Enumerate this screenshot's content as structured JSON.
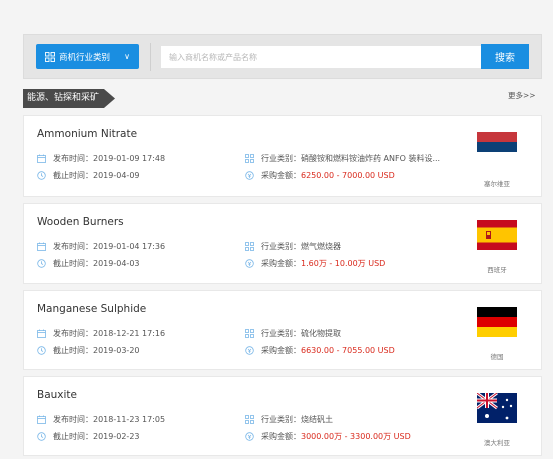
{
  "search": {
    "category_label": "商机行业类别",
    "placeholder": "输入商机名称或产品名称",
    "button_label": "搜索"
  },
  "section": {
    "title": "能源、钻探和采矿",
    "more_label": "更多>>"
  },
  "labels": {
    "publish": "发布时间：",
    "deadline": "截止时间：",
    "industry": "行业类别：",
    "amount": "采购金额："
  },
  "cards": [
    {
      "title": "Ammonium Nitrate",
      "publish_time": "2019-01-09 17:48",
      "deadline": "2019-04-09",
      "industry": "硝酸铵和燃料铵油炸药 ANFO 装料设...",
      "amount": "6250.00 - 7000.00 USD",
      "country": "塞尔维亚",
      "flag": "serbia"
    },
    {
      "title": "Wooden Burners",
      "publish_time": "2019-01-04 17:36",
      "deadline": "2019-04-03",
      "industry": "燃气燃烧器",
      "amount": "1.60万 - 10.00万 USD",
      "country": "西班牙",
      "flag": "spain"
    },
    {
      "title": "Manganese Sulphide",
      "publish_time": "2018-12-21 17:16",
      "deadline": "2019-03-20",
      "industry": "硫化物提取",
      "amount": "6630.00 - 7055.00 USD",
      "country": "德国",
      "flag": "germany"
    },
    {
      "title": "Bauxite",
      "publish_time": "2018-11-23 17:05",
      "deadline": "2019-02-23",
      "industry": "烧结矾土",
      "amount": "3000.00万 - 3300.00万 USD",
      "country": "澳大利亚",
      "flag": "australia"
    }
  ]
}
